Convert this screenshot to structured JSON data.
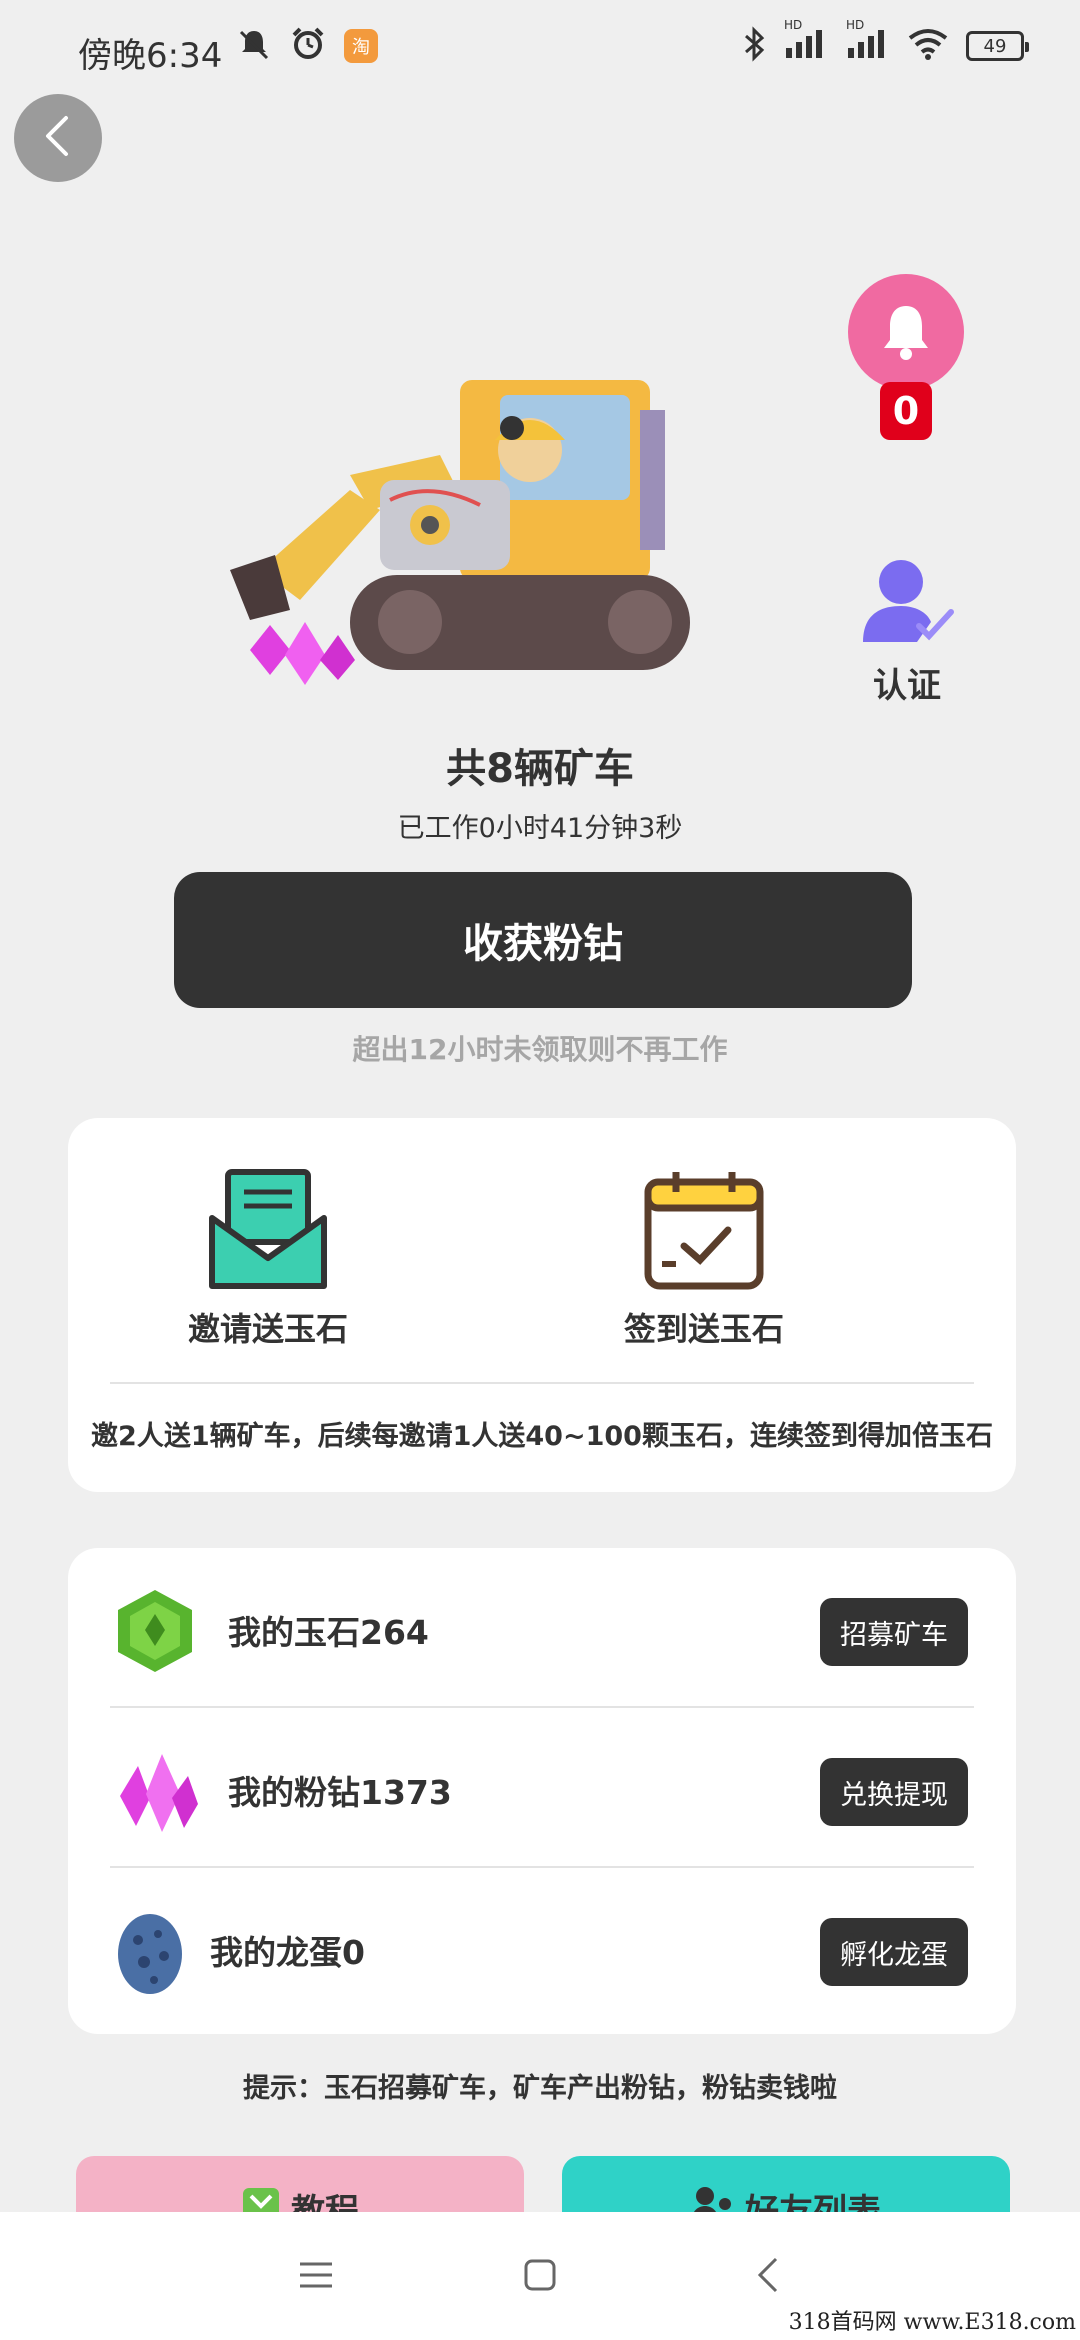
{
  "status_bar": {
    "time": "傍晚6:34",
    "taobao_badge": "淘",
    "hd_label": "HD",
    "battery": "49"
  },
  "icons": {
    "back": "chevron-left-icon",
    "bell": "bell-icon",
    "verify": "user-check-icon"
  },
  "notifications": {
    "count": "0"
  },
  "verify": {
    "label": "认证"
  },
  "mining": {
    "count_text": "共8辆矿车",
    "work_time": "已工作0小时41分钟3秒",
    "harvest_button": "收获粉钻",
    "warning": "超出12小时未领取则不再工作"
  },
  "features": {
    "invite_label": "邀请送玉石",
    "signin_label": "签到送玉石",
    "promo_text": "邀2人送1辆矿车，后续每邀请1人送40~100颗玉石，连续签到得加倍玉石"
  },
  "assets": [
    {
      "label": "我的玉石264",
      "button": "招募矿车"
    },
    {
      "label": "我的粉钻1373",
      "button": "兑换提现"
    },
    {
      "label": "我的龙蛋0",
      "button": "孵化龙蛋"
    }
  ],
  "tip": "提示：玉石招募矿车，矿车产出粉钻，粉钻卖钱啦",
  "bottom_buttons": {
    "left": "教程",
    "right": "好友列表"
  },
  "watermark": "318首码网 www.E318.com",
  "colors": {
    "dark_button": "#333333",
    "bell": "#f06aa1",
    "badge_red": "#e0001b",
    "verify_purple": "#7b6cf0"
  }
}
